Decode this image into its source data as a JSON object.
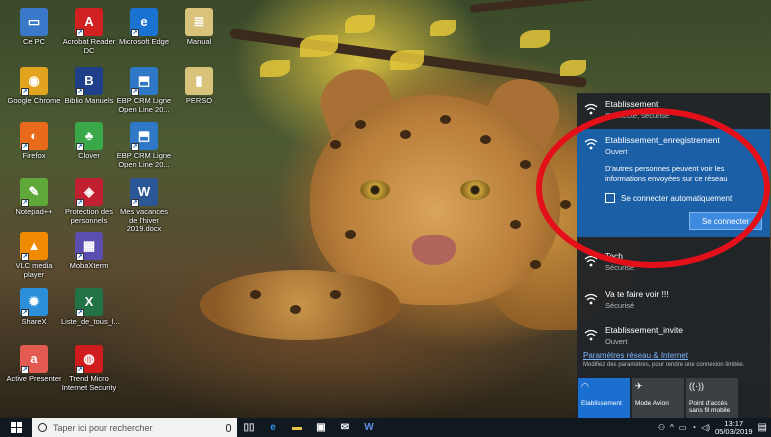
{
  "desktop": {
    "icons": [
      {
        "label": "Ce PC",
        "icon": "computer-icon",
        "color": "#3a79c9"
      },
      {
        "label": "Acrobat Reader DC",
        "icon": "acrobat-icon",
        "color": "#d02020"
      },
      {
        "label": "Microsoft Edge",
        "icon": "edge-icon",
        "color": "#1a73d0"
      },
      {
        "label": "Manual",
        "icon": "document-icon",
        "color": "#d9c27a"
      },
      {
        "label": "Google Chrome",
        "icon": "chrome-icon",
        "color": "#e2a31f"
      },
      {
        "label": "Biblio Manuels",
        "icon": "biblio-icon",
        "color": "#1e3f8a"
      },
      {
        "label": "EBP CRM Ligne Open Line 20...",
        "icon": "ebp-icon",
        "color": "#2e78c7"
      },
      {
        "label": "PERSO",
        "icon": "folder-icon",
        "color": "#d9c27a"
      },
      {
        "label": "Firefox",
        "icon": "firefox-icon",
        "color": "#e86a1a"
      },
      {
        "label": "Clover",
        "icon": "clover-icon",
        "color": "#3aa848"
      },
      {
        "label": "EBP CRM Ligne Open Line 20...",
        "icon": "ebp-icon",
        "color": "#2e78c7"
      },
      {
        "label": "Notepad++",
        "icon": "notepad-icon",
        "color": "#5fa83a"
      },
      {
        "label": "Protection des personnels",
        "icon": "shield-icon",
        "color": "#c02030"
      },
      {
        "label": "Mes vacances de l'hiver 2019.docx",
        "icon": "word-icon",
        "color": "#2b5797"
      },
      {
        "label": "VLC media player",
        "icon": "vlc-icon",
        "color": "#f08a00"
      },
      {
        "label": "MobaXterm",
        "icon": "terminal-icon",
        "color": "#5a4fb0"
      },
      {
        "label": "ShareX",
        "icon": "sharex-icon",
        "color": "#2b8fd9"
      },
      {
        "label": "Liste_de_tous_l...",
        "icon": "excel-icon",
        "color": "#217346"
      },
      {
        "label": "Active Presenter",
        "icon": "presenter-icon",
        "color": "#e25a50"
      },
      {
        "label": "Trend Micro Internet Security",
        "icon": "trendmicro-icon",
        "color": "#d01c1c"
      }
    ]
  },
  "network_flyout": {
    "networks": [
      {
        "name": "Etablissement",
        "status": "Connecté, sécurisé"
      },
      {
        "name": "Etablissement_enregistrement",
        "status": "Ouvert",
        "selected": true,
        "warning": "D'autres personnes peuvent voir les informations envoyées sur ce réseau",
        "auto_connect_label": "Se connecter automatiquement",
        "connect_label": "Se connecter"
      },
      {
        "name": "Tech",
        "status": "Sécurisé"
      },
      {
        "name": "Va te faire voir !!!",
        "status": "Sécurisé"
      },
      {
        "name": "Etablissement_invite",
        "status": "Ouvert"
      }
    ],
    "settings_link": "Paramètres réseau & Internet",
    "settings_desc": "Modifiez des paramètres, pour rendre une connexion limitée.",
    "quick_actions": [
      {
        "label": "Etablissement",
        "icon": "wifi-icon",
        "active": true
      },
      {
        "label": "Mode Avion",
        "icon": "airplane-icon",
        "active": false
      },
      {
        "label": "Point d'accès sans fil mobile",
        "icon": "hotspot-icon",
        "active": false
      }
    ],
    "accent": "#1b5fa6"
  },
  "taskbar": {
    "search_placeholder": "Taper ici pour rechercher",
    "clock_time": "13:17",
    "clock_date": "05/03/2019"
  }
}
